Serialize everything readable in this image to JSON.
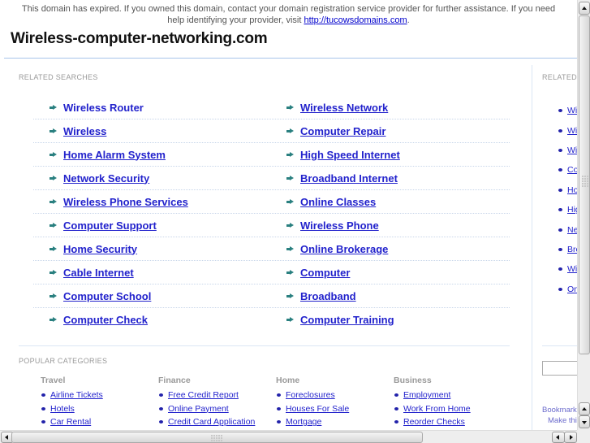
{
  "notice": {
    "text": "This domain has expired. If you owned this domain, contact your domain registration service provider for further assistance. If you need help identifying your provider, visit ",
    "link_text": "http://tucowsdomains.com",
    "suffix": "."
  },
  "site_title": "Wireless-computer-networking.com",
  "related_searches": {
    "label": "RELATED SEARCHES",
    "rows": [
      [
        "Wireless Router",
        "Wireless Network"
      ],
      [
        "Wireless",
        "Computer Repair"
      ],
      [
        "Home Alarm System",
        "High Speed Internet"
      ],
      [
        "Network Security",
        "Broadband Internet"
      ],
      [
        "Wireless Phone Services",
        "Online Classes"
      ],
      [
        "Computer Support",
        "Wireless Phone"
      ],
      [
        "Home Security",
        "Online Brokerage"
      ],
      [
        "Cable Internet",
        "Computer"
      ],
      [
        "Computer School",
        "Broadband"
      ],
      [
        "Computer Check",
        "Computer Training"
      ]
    ],
    "hovered": "Wireless Router",
    "link_color": "#2222cc",
    "arrow_color": "#2a8080"
  },
  "popular_categories": {
    "label": "POPULAR CATEGORIES",
    "columns": [
      {
        "heading": "Travel",
        "items": [
          "Airline Tickets",
          "Hotels",
          "Car Rental"
        ]
      },
      {
        "heading": "Finance",
        "items": [
          "Free Credit Report",
          "Online Payment",
          "Credit Card Application"
        ]
      },
      {
        "heading": "Home",
        "items": [
          "Foreclosures",
          "Houses For Sale",
          "Mortgage"
        ]
      },
      {
        "heading": "Business",
        "items": [
          "Employment",
          "Work From Home",
          "Reorder Checks"
        ]
      }
    ]
  },
  "sidebar": {
    "label": "RELATED",
    "items": [
      "Wi",
      "Wi",
      "Wi",
      "Co",
      "Ho",
      "Hig",
      "Ne",
      "Bro",
      "Wi",
      "On"
    ],
    "search_value": "",
    "bookmark_text": "Bookmark",
    "make_text": "Make thi"
  }
}
